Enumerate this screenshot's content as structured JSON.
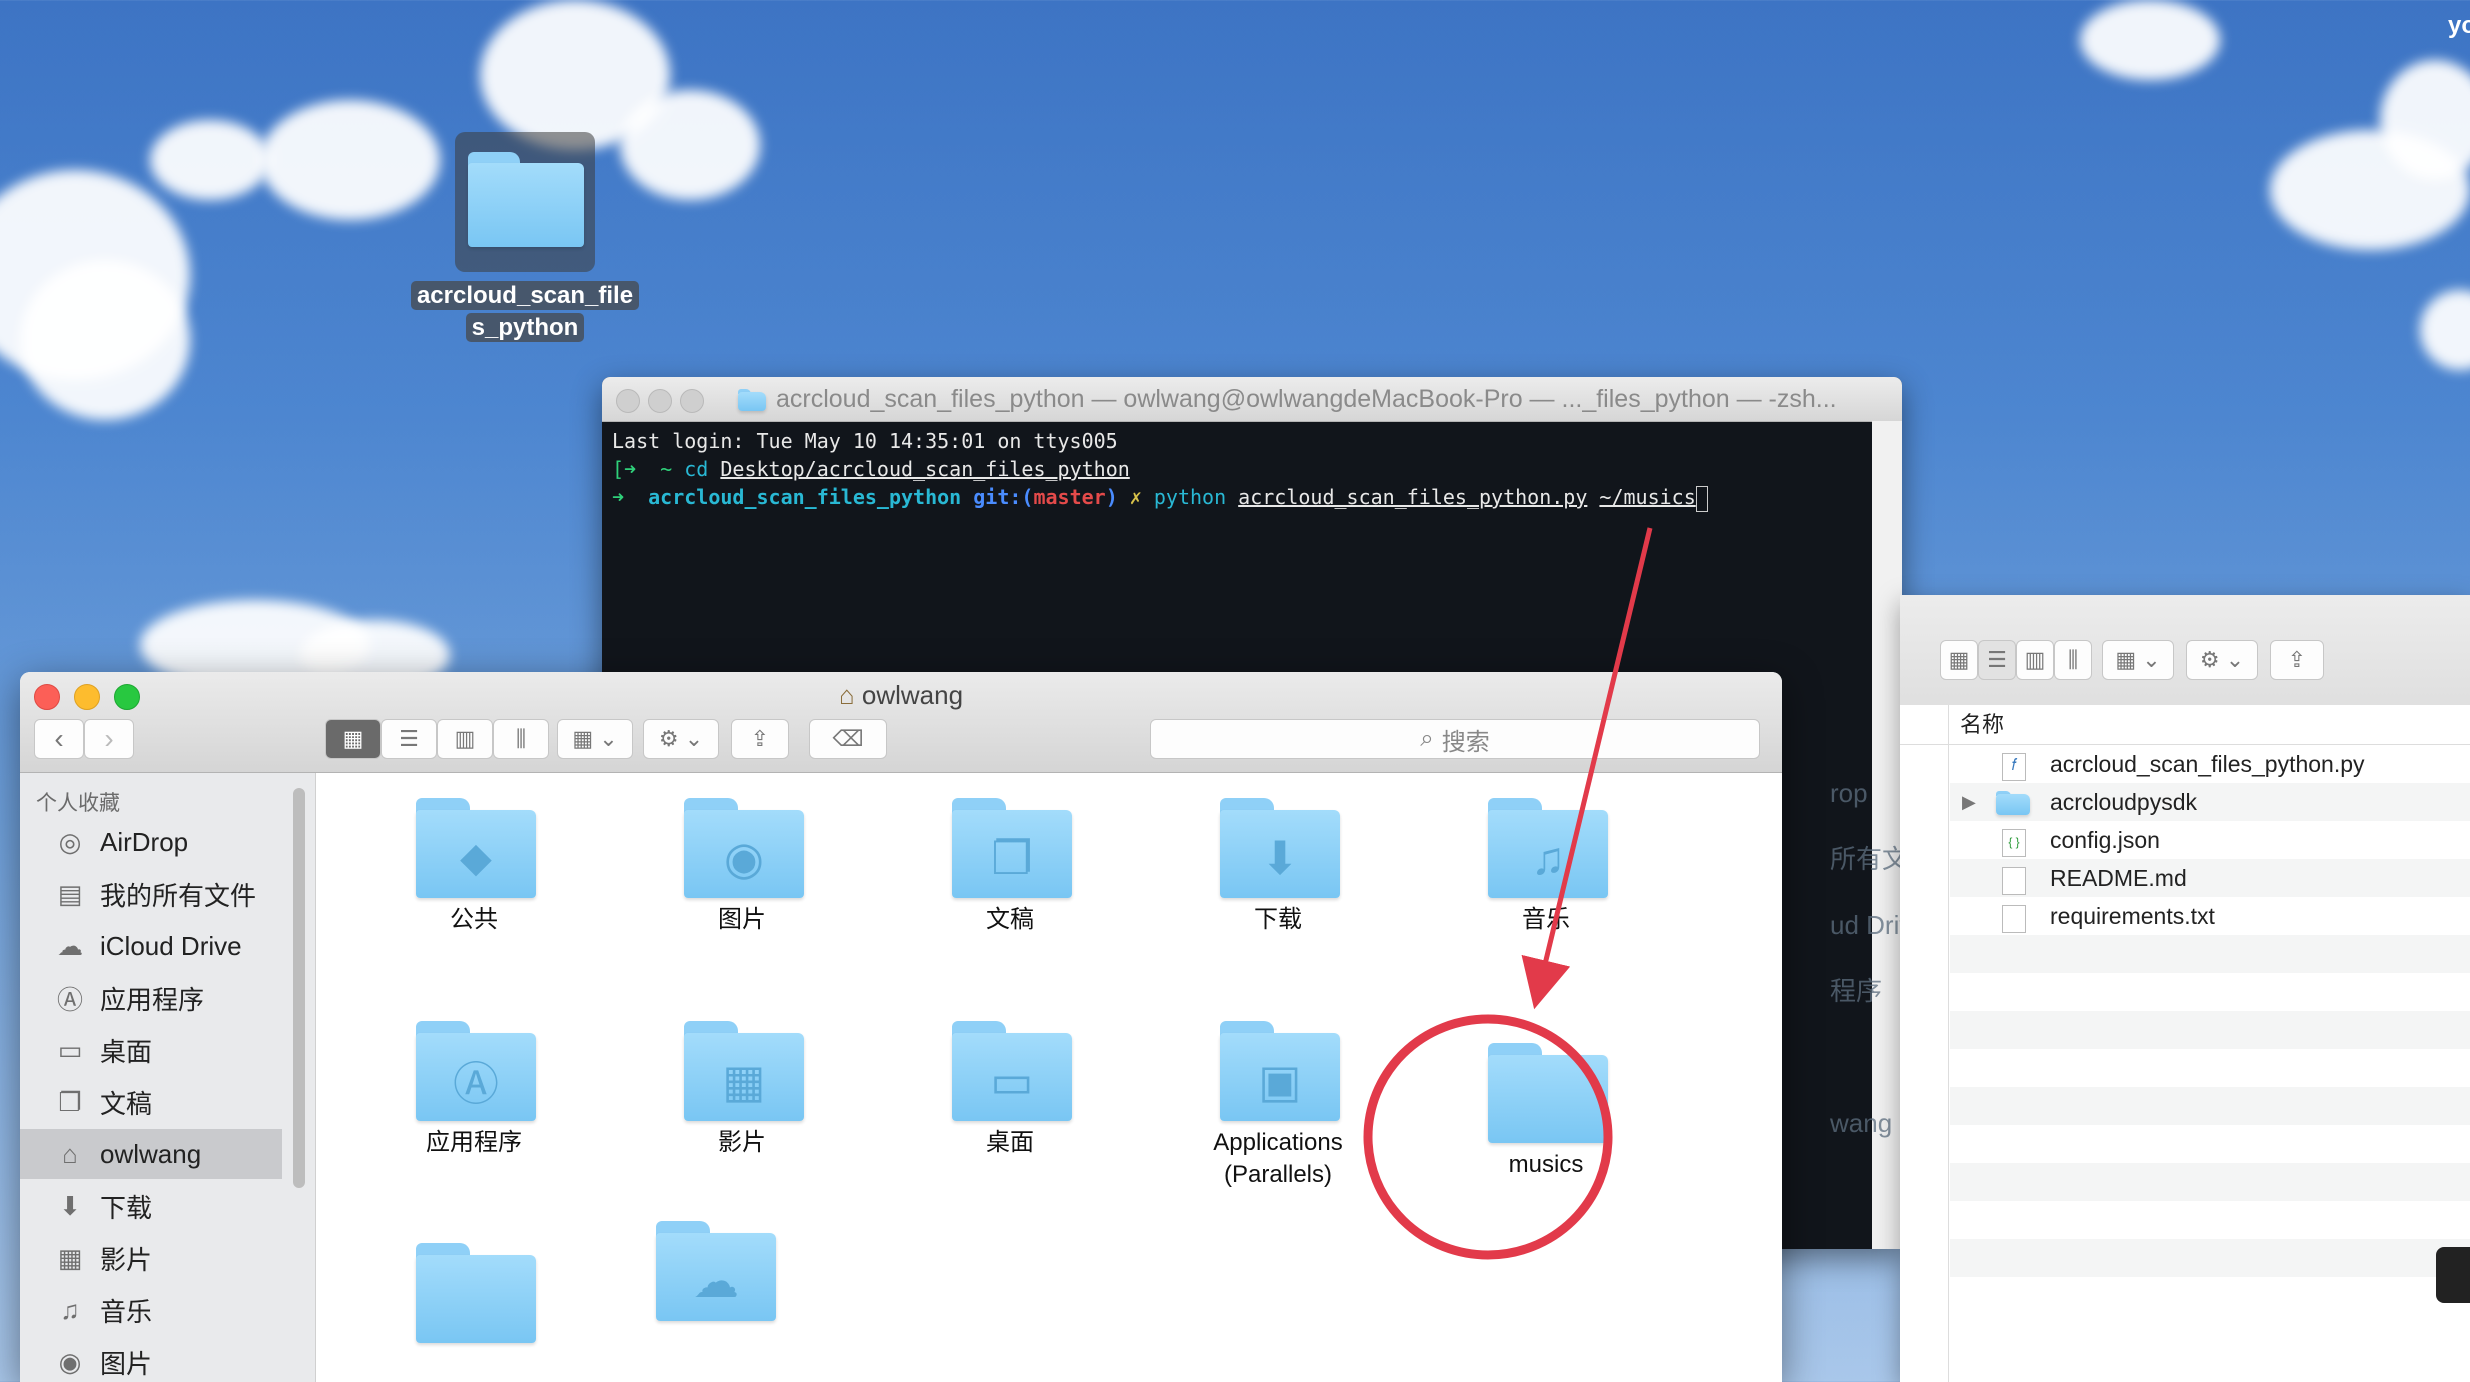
{
  "desktop": {
    "folder_name_line1": "acrcloud_scan_file",
    "folder_name_line2": "s_python",
    "corner_text": "yo"
  },
  "terminal": {
    "title": "acrcloud_scan_files_python — owlwang@owlwangdeMacBook-Pro — ..._files_python — -zsh...",
    "line1": "Last login: Tue May 10 14:35:01 on ttys005",
    "line2_prompt": "[➜  ~ ",
    "line2_cmd": "cd ",
    "line2_arg": "Desktop/acrcloud_scan_files_python",
    "line3_arrow": "➜  ",
    "line3_dir": "acrcloud_scan_files_python",
    "line3_git": " git:(",
    "line3_branch": "master",
    "line3_git_close": ")",
    "line3_x": " ✗ ",
    "line3_cmd": "python ",
    "line3_arg1": "acrcloud_scan_files_python.py",
    "line3_arg2": "~/musics"
  },
  "finder": {
    "title": "owlwang",
    "search_placeholder": "搜索",
    "sidebar_heading": "个人收藏",
    "sidebar": [
      {
        "label": "AirDrop",
        "icon": "airdrop-icon"
      },
      {
        "label": "我的所有文件",
        "icon": "all-files-icon"
      },
      {
        "label": "iCloud Drive",
        "icon": "icloud-icon"
      },
      {
        "label": "应用程序",
        "icon": "applications-icon"
      },
      {
        "label": "桌面",
        "icon": "desktop-icon"
      },
      {
        "label": "文稿",
        "icon": "documents-icon"
      },
      {
        "label": "owlwang",
        "icon": "home-icon"
      },
      {
        "label": "下载",
        "icon": "downloads-icon"
      },
      {
        "label": "影片",
        "icon": "movies-icon"
      },
      {
        "label": "音乐",
        "icon": "music-icon"
      },
      {
        "label": "图片",
        "icon": "pictures-icon"
      }
    ],
    "items": [
      {
        "label": "公共",
        "icon": "public-folder-icon"
      },
      {
        "label": "图片",
        "icon": "pictures-folder-icon"
      },
      {
        "label": "文稿",
        "icon": "documents-folder-icon"
      },
      {
        "label": "下载",
        "icon": "downloads-folder-icon"
      },
      {
        "label": "音乐",
        "icon": "music-folder-icon"
      },
      {
        "label": "应用程序",
        "icon": "applications-folder-icon"
      },
      {
        "label": "影片",
        "icon": "movies-folder-icon"
      },
      {
        "label": "桌面",
        "icon": "desktop-folder-icon"
      },
      {
        "label": "Applications\n(Parallels)",
        "icon": "parallels-folder-icon"
      },
      {
        "label": "musics",
        "icon": "folder-icon"
      }
    ]
  },
  "finder_right": {
    "column_name": "名称",
    "files": [
      {
        "name": "acrcloud_scan_files_python.py",
        "icon": "python-file-icon"
      },
      {
        "name": "acrcloudpysdk",
        "icon": "folder-icon"
      },
      {
        "name": "config.json",
        "icon": "json-file-icon"
      },
      {
        "name": "README.md",
        "icon": "text-file-icon"
      },
      {
        "name": "requirements.txt",
        "icon": "text-file-icon"
      }
    ]
  },
  "background_finder_fragments": [
    "rop",
    "所有文",
    "ud Driv",
    "程序",
    "wang"
  ],
  "colors": {
    "annotation_red": "#e23a4a",
    "terminal_green": "#2fd07a",
    "terminal_cyan": "#29b8d4",
    "folder_blue": "#8fd0f7"
  }
}
